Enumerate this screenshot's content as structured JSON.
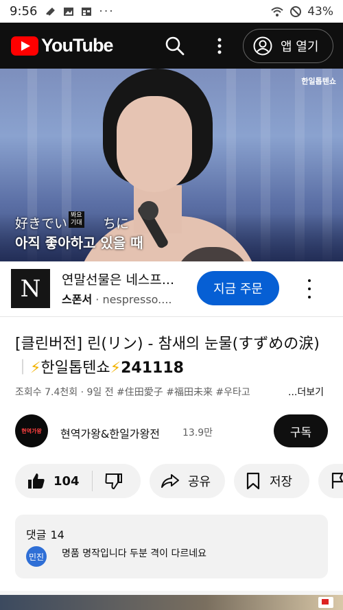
{
  "status_bar": {
    "time": "9:56",
    "left_icons": [
      "link-icon",
      "image-icon",
      "calendar-icon",
      "more-dots"
    ],
    "more": "···",
    "battery": "43%"
  },
  "header": {
    "logo_text": "YouTube",
    "open_app_label": "앱 열기"
  },
  "video": {
    "watermark": "한일톱텐쇼",
    "lyric_jp_a": "好きでい",
    "lyric_jp_b": "ちに",
    "lyric_note_1": "봐요",
    "lyric_note_2": "기대",
    "lyric_ko": "아직 좋아하고 있을 때"
  },
  "ad": {
    "logo_letter": "N",
    "title": "연말선물은 네스프...",
    "sponsor_label": "스폰서",
    "domain": "nespresso....",
    "cta": "지금 주문"
  },
  "title": {
    "part1": "[클린버전] 린(リン) - 참새의 눈물(すずめの涙)",
    "sep": "｜",
    "bolt": "⚡",
    "show": "한일톱텐쇼",
    "date": "241118"
  },
  "meta": {
    "line": "조회수 7.4천회 · 9일 전  #住田愛子 #福田未来 #우타고",
    "more": "...더보기"
  },
  "channel": {
    "avatar_text": "현역가왕",
    "name": "현역가왕&한일가왕전",
    "subs": "13.9만",
    "subscribe": "구독"
  },
  "actions": {
    "likes": "104",
    "share": "공유",
    "save": "저장"
  },
  "comments": {
    "label": "댓글",
    "count": "14",
    "avatar": "민진",
    "top_comment": "명품 명작입니다 두분 격이 다르네요"
  },
  "colors": {
    "brand_red": "#ff0000",
    "cta_blue": "#065fd4",
    "pill_bg": "#f2f2f2"
  }
}
